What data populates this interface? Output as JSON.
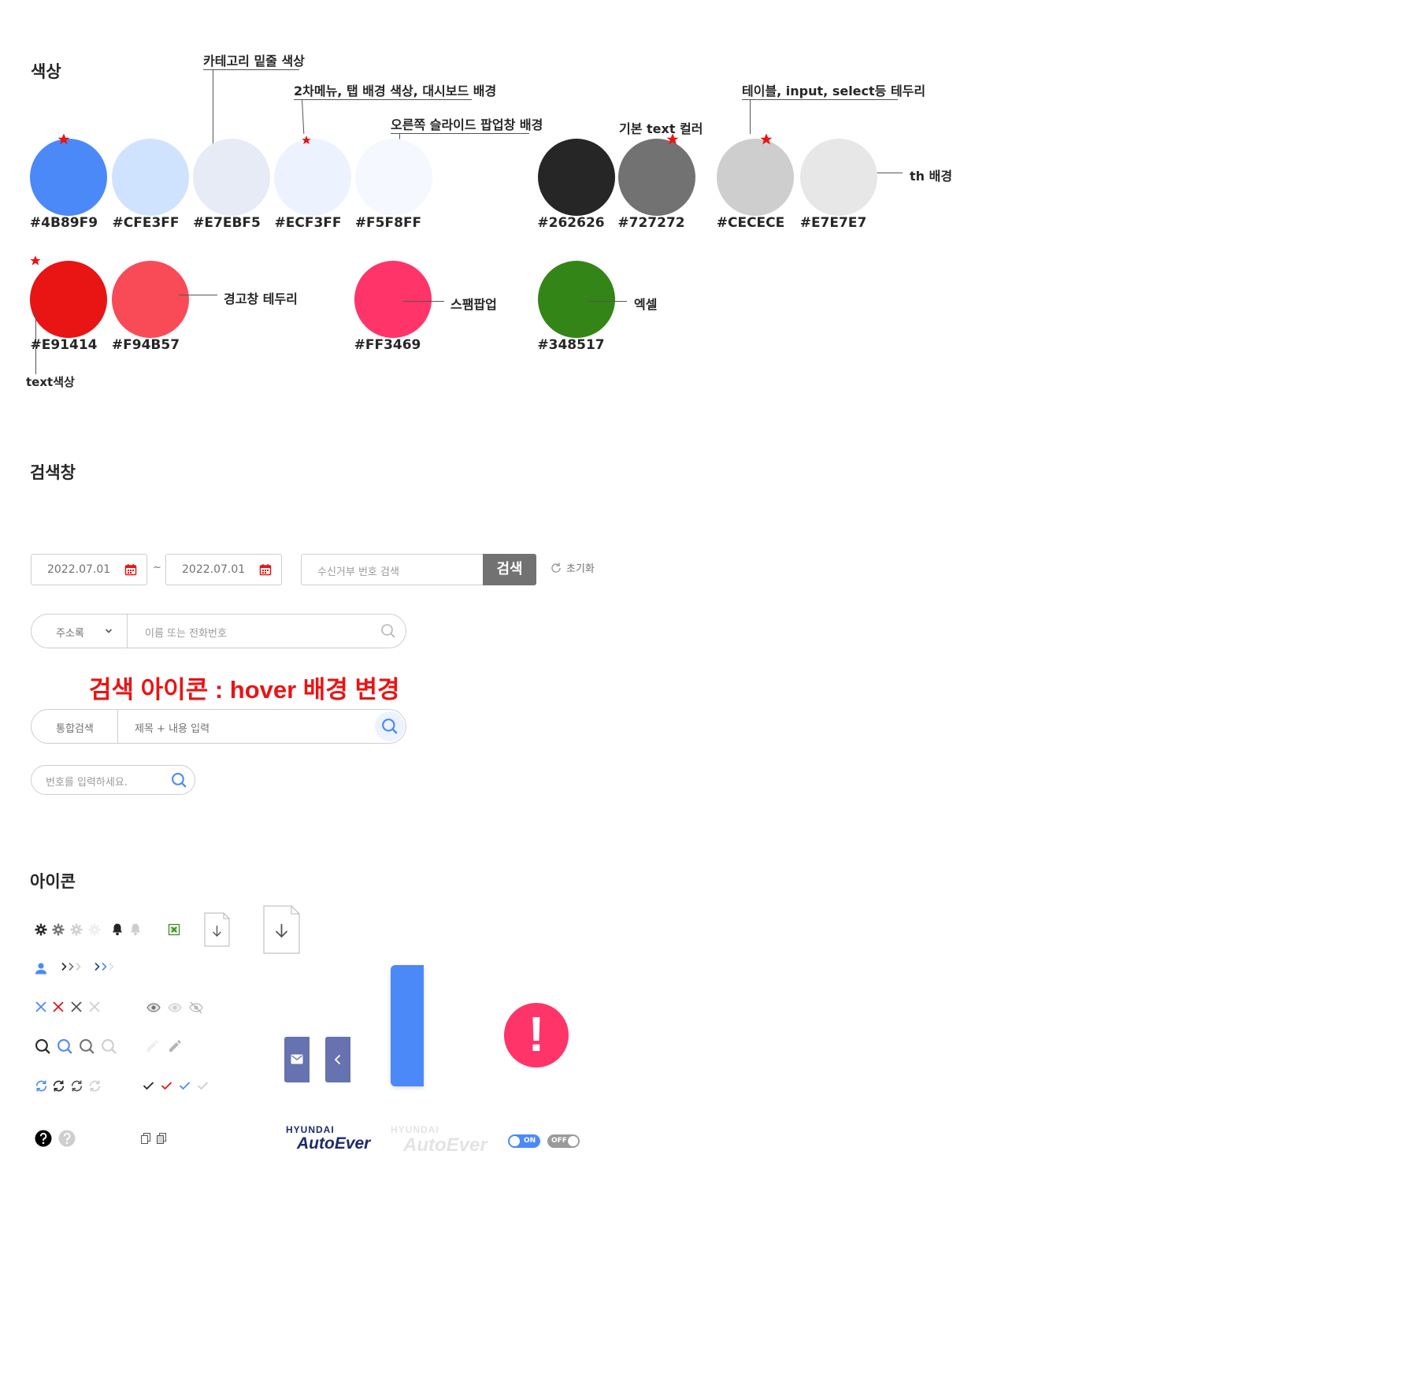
{
  "sections": {
    "colors_title": "색상",
    "search_title": "검색창",
    "icons_title": "아이콘"
  },
  "colors": {
    "row1": [
      {
        "hex": "#4B89F9",
        "label": "#4B89F9",
        "starred": true
      },
      {
        "hex": "#CFE3FF",
        "label": "#CFE3FF",
        "starred": false
      },
      {
        "hex": "#E7EBF5",
        "label": "#E7EBF5",
        "starred": false
      },
      {
        "hex": "#ECF3FF",
        "label": "#ECF3FF",
        "starred": true
      },
      {
        "hex": "#F5F8FF",
        "label": "#F5F8FF",
        "starred": false
      },
      {
        "hex": "#262626",
        "label": "#262626",
        "starred": false
      },
      {
        "hex": "#727272",
        "label": "#727272",
        "starred": true
      },
      {
        "hex": "#CECECE",
        "label": "#CECECE",
        "starred": true
      },
      {
        "hex": "#E7E7E7",
        "label": "#E7E7E7",
        "starred": false
      }
    ],
    "row2": [
      {
        "hex": "#E91414",
        "label": "#E91414",
        "starred": true
      },
      {
        "hex": "#F94B57",
        "label": "#F94B57",
        "starred": false
      },
      {
        "hex": "#FF3469",
        "label": "#FF3469",
        "starred": false
      },
      {
        "hex": "#348517",
        "label": "#348517",
        "starred": false
      }
    ],
    "callouts": {
      "category_underline": "카테고리 밑줄 색상",
      "submenu_bg": "2차메뉴, 탭 배경 색상, 대시보드 배경",
      "slide_popup_bg": "오른쪽 슬라이드 팝업창 배경",
      "basic_text": "기본 text 컬러",
      "table_border": "테이블, input, select등 테두리",
      "th_bg": "th 배경",
      "alert_border": "경고창 테두리",
      "spam_popup": "스팸팝업",
      "excel": "엑셀",
      "text_color": "text색상"
    },
    "star_color": "#E91414"
  },
  "search": {
    "date_from": "2022.07.01",
    "date_to": "2022.07.01",
    "range_sep": "~",
    "reject_placeholder": "수신거부 번호 검색",
    "search_button": "검색",
    "reset_label": "초기화",
    "addressbook_select": "주소록",
    "addressbook_placeholder": "이름 또는 전화번호",
    "hover_note": "검색 아이콘 : hover 배경 변경",
    "integrated_label": "통합검색",
    "integrated_placeholder": "제목 + 내용 입력",
    "number_placeholder": "번호를 입력하세요."
  },
  "icons": {
    "brand_top": "HYUNDAI",
    "brand_bottom": "AutoEver",
    "toggle_on": "ON",
    "toggle_off": "OFF",
    "alert_mark": "!"
  }
}
